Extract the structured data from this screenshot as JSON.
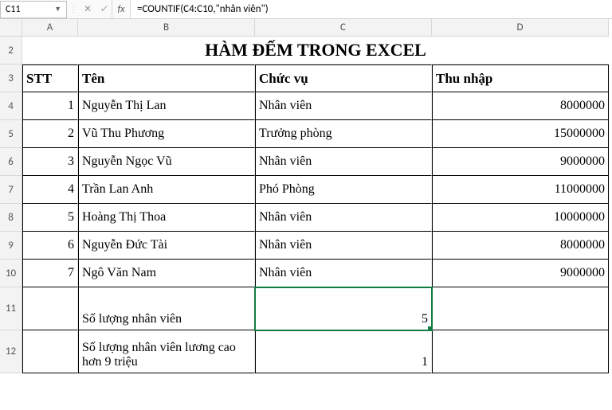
{
  "formula_bar": {
    "cell_ref": "C11",
    "formula": "=COUNTIF(C4:C10,\"nhân viên\")"
  },
  "columns": [
    "A",
    "B",
    "C",
    "D"
  ],
  "rows": [
    "2",
    "3",
    "4",
    "5",
    "6",
    "7",
    "8",
    "9",
    "10",
    "11",
    "12"
  ],
  "title": "HÀM ĐẾM TRONG EXCEL",
  "headers": {
    "stt": "STT",
    "ten": "Tên",
    "chucvu": "Chức vụ",
    "thunhap": "Thu nhập"
  },
  "data": [
    {
      "stt": "1",
      "ten": "Nguyễn Thị Lan",
      "chucvu": "Nhân viên",
      "thunhap": "8000000"
    },
    {
      "stt": "2",
      "ten": "Vũ Thu Phương",
      "chucvu": "Trưởng phòng",
      "thunhap": "15000000"
    },
    {
      "stt": "3",
      "ten": "Nguyễn Ngọc Vũ",
      "chucvu": "Nhân viên",
      "thunhap": "9000000"
    },
    {
      "stt": "4",
      "ten": "Trần Lan Anh",
      "chucvu": "Phó Phòng",
      "thunhap": "11000000"
    },
    {
      "stt": "5",
      "ten": "Hoàng Thị Thoa",
      "chucvu": "Nhân viên",
      "thunhap": "10000000"
    },
    {
      "stt": "6",
      "ten": "Nguyễn Đức Tài",
      "chucvu": "Nhân viên",
      "thunhap": "8000000"
    },
    {
      "stt": "7",
      "ten": "Ngô Văn Nam",
      "chucvu": "Nhân viên",
      "thunhap": "9000000"
    }
  ],
  "summary": {
    "row11_label": "Số lượng nhân viên",
    "row11_value": "5",
    "row12_label": "Số lượng nhân viên lương cao hơn 9 triệu",
    "row12_value": "1"
  }
}
